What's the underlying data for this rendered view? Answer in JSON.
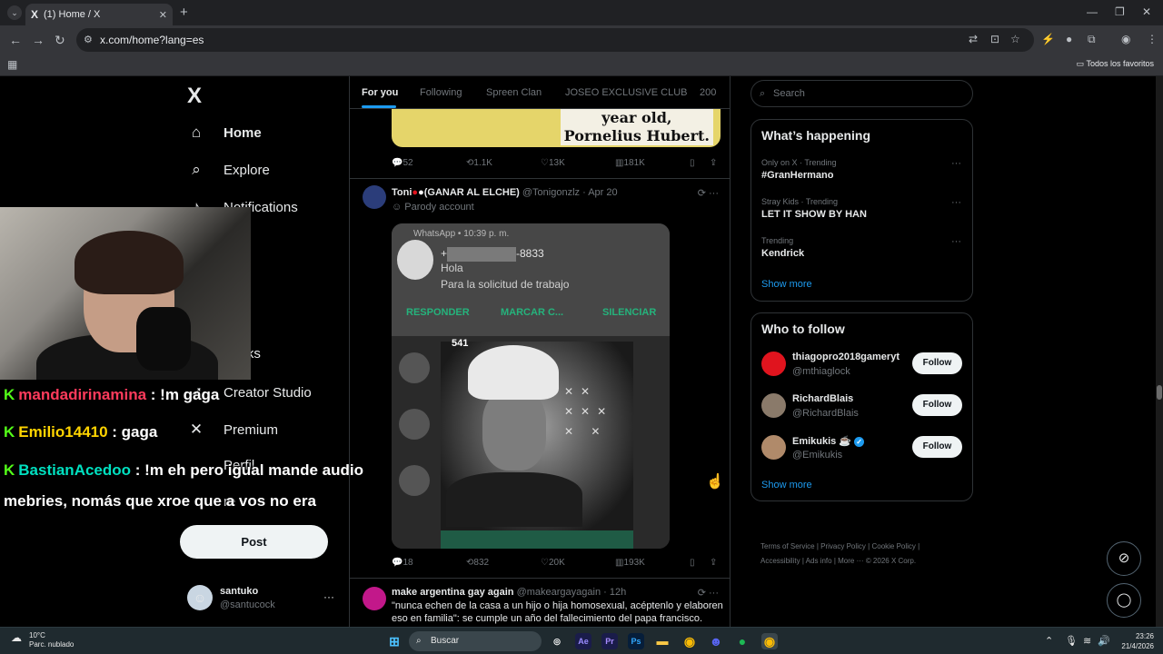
{
  "browser": {
    "tab_title": "(1) Home / X",
    "tab_logo": "X",
    "url": "x.com/home?lang=es",
    "bookmarks_all": "Todos los favoritos"
  },
  "leftnav": {
    "logo": "X",
    "items": [
      {
        "label": "Home",
        "icon": "home-icon"
      },
      {
        "label": "Explore",
        "icon": "search-icon"
      },
      {
        "label": "Notifications",
        "icon": "bell-icon"
      },
      {
        "label": "Creator Studio",
        "icon": "rocket-icon"
      },
      {
        "label": "Premium",
        "icon": "x-icon"
      }
    ],
    "partial_bookmarks": "marks",
    "partial_profile": "Perfil",
    "partial_more": "re",
    "post_label": "Post",
    "account": {
      "name": "santuko",
      "handle": "@santucock"
    }
  },
  "stream_chat": [
    {
      "user": "mandadirinamina",
      "message": " : !m gaga"
    },
    {
      "user": "Emilio14410",
      "message": " : gaga"
    },
    {
      "user": "BastianAcedoo",
      "message": " : !m eh pero igual mande audio"
    },
    {
      "user": "",
      "message": "mebries, nomás que xroe que a vos no era"
    }
  ],
  "feed": {
    "tabs": [
      "For you",
      "Following",
      "Spreen Clan",
      "JOSEO EXCLUSIVE CLUB",
      "200"
    ],
    "tweet1": {
      "image_text": "year old,\nPornelius Hubert.",
      "replies": "52",
      "reposts": "1.1K",
      "likes": "13K",
      "views": "181K"
    },
    "tweet2": {
      "name": "Toni",
      "name_suffix": "(GANAR AL ELCHE)",
      "handle": "@Tonigonzlz",
      "date": "· Apr 20",
      "sub": "Parody account",
      "whatsapp_app": "WhatsApp • 10:39 p. m.",
      "whatsapp_number_prefix": "+",
      "whatsapp_number_suffix": "-8833",
      "whatsapp_hola": "Hola",
      "whatsapp_message": "Para la solicitud de trabajo",
      "action_reply": "RESPONDER",
      "action_mark": "MARCAR C...",
      "action_mute": "SILENCIAR",
      "video_label": "541",
      "replies": "18",
      "reposts": "832",
      "likes": "20K",
      "views": "193K"
    },
    "tweet3": {
      "name": "make argentina gay again",
      "handle": "@makeargayagain",
      "date": "· 12h",
      "text1": "\"nunca echen de la casa a un hijo o hija homosexual, acéptenlo y elaboren",
      "text2": "eso en familia\": se cumple un año del fallecimiento del papa francisco."
    }
  },
  "right": {
    "search_placeholder": "Search",
    "happening_title": "What’s happening",
    "trends": [
      {
        "context": "Only on X · Trending",
        "name": "#GranHermano"
      },
      {
        "context": "Stray Kids · Trending",
        "name": "LET IT SHOW BY HAN"
      },
      {
        "context": "Trending",
        "name": "Kendrick"
      }
    ],
    "show_more": "Show more",
    "wtf_title": "Who to follow",
    "follow": [
      {
        "name": "thiagopro2018gameryt",
        "handle": "@mthiaglock",
        "button": "Follow",
        "avatar_color": "#e0141e"
      },
      {
        "name": "RichardBlais",
        "handle": "@RichardBlais",
        "button": "Follow",
        "avatar_color": "#8a7a6a"
      },
      {
        "name": "Emikukis",
        "handle": "@Emikukis",
        "button": "Follow",
        "avatar_color": "#b08a6a"
      }
    ],
    "footer": [
      "Terms of Service",
      "|",
      "Privacy Policy",
      "|",
      "Cookie Policy",
      "|",
      "Accessibility",
      "|",
      "Ads info",
      "|",
      "More ···",
      "© 2026 X Corp."
    ]
  },
  "taskbar": {
    "weather_temp": "10°C",
    "weather_desc": "Parc. nublado",
    "search_label": "Buscar",
    "time": "23:26",
    "date": "21/4/2026"
  },
  "colors": {
    "accent": "#1d9bf0",
    "post_button": "#eff3f4",
    "background": "#000000"
  }
}
